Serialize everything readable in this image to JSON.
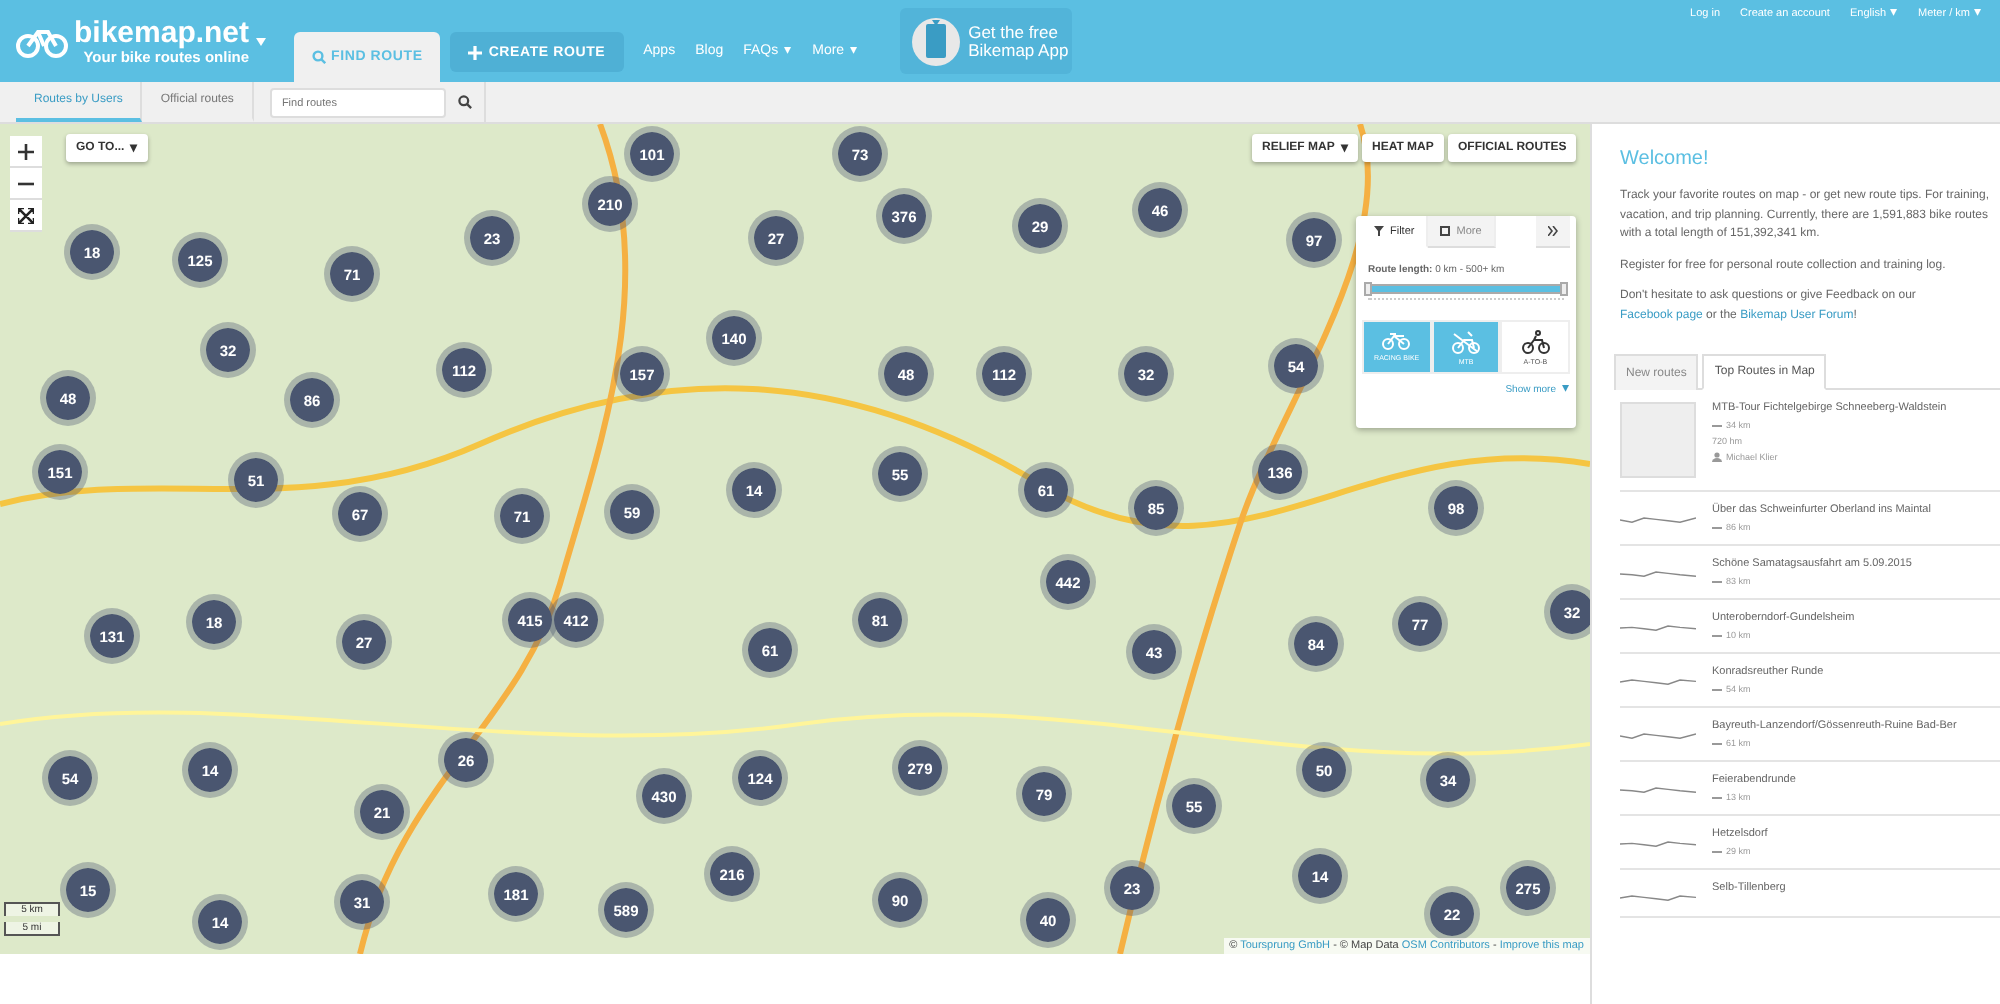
{
  "header": {
    "logo": "bikemap.net",
    "tagline": "Your bike routes online",
    "tabs": [
      {
        "label": "FIND ROUTE",
        "kind": "find",
        "selected": true
      },
      {
        "label": "CREATE ROUTE",
        "kind": "create",
        "selected": false
      }
    ],
    "links": [
      {
        "label": "Apps"
      },
      {
        "label": "Blog"
      },
      {
        "label": "FAQs",
        "caret": "▾"
      },
      {
        "label": "More",
        "caret": "▾"
      }
    ],
    "promo": "Get the free Bikemap App",
    "account": [
      {
        "label": "Log in"
      },
      {
        "label": "Create an account"
      },
      {
        "label": "English",
        "caret": "▾"
      },
      {
        "label": "Meter / km",
        "caret": "▾"
      }
    ]
  },
  "subnav": {
    "tabs": [
      {
        "label": "Routes by Users",
        "selected": true
      },
      {
        "label": "Official routes",
        "selected": false
      }
    ],
    "search": {
      "placeholder": "Find routes"
    }
  },
  "map": {
    "goto": "GO TO...",
    "goto_caret": "▾",
    "layers": [
      {
        "label": "RELIEF MAP",
        "caret": "▾"
      },
      {
        "label": "HEAT MAP"
      },
      {
        "label": "OFFICIAL ROUTES"
      }
    ],
    "clusters": [
      "101",
      "73",
      "210",
      "376",
      "29",
      "46",
      "18",
      "125",
      "71",
      "23",
      "27",
      "97",
      "32",
      "112",
      "157",
      "140",
      "48",
      "112",
      "32",
      "54",
      "48",
      "86",
      "151",
      "51",
      "67",
      "71",
      "59",
      "14",
      "55",
      "61",
      "85",
      "136",
      "98",
      "131",
      "18",
      "27",
      "415",
      "412",
      "61",
      "81",
      "442",
      "43",
      "84",
      "77",
      "32",
      "54",
      "14",
      "21",
      "26",
      "430",
      "124",
      "279",
      "79",
      "55",
      "50",
      "34",
      "15",
      "14",
      "31",
      "181",
      "589",
      "216",
      "90",
      "40",
      "23",
      "14",
      "22",
      "275"
    ],
    "scale": [
      "5 km",
      "5 mi"
    ],
    "attribution": {
      "prefix": "©",
      "owner": "Toursprung GmbH",
      "data_label": "- © Map Data",
      "data_link": "OSM Contributors",
      "separator": "-",
      "improve": "Improve this map"
    },
    "filter": {
      "tabs": [
        {
          "label": "Filter",
          "selected": true
        },
        {
          "label": "More",
          "selected": false
        }
      ],
      "length_label": "**Route length:** 0 km - 500+ km",
      "length": {
        "level": 1
      },
      "bikes": [
        {
          "label": "RACING BIKE",
          "kind": "racing",
          "selected": true
        },
        {
          "label": "MTB",
          "kind": "mtb",
          "selected": true
        },
        {
          "label": "A-TO-B",
          "kind": "atob",
          "selected": false
        }
      ],
      "show_more": "Show more",
      "show_more_caret": "▾"
    }
  },
  "sidebar": {
    "title": "Welcome!",
    "paragraphs": [
      "Track your favorite routes on map - or get new route tips. For training, vacation, and trip planning. Currently, there are 1,591,883 bike routes with a total length of 151,392,341 km.",
      "Register for free for personal route collection and training log."
    ],
    "feedback": {
      "before": "Don't hesitate to ask questions or give Feedback on our",
      "link_1": "Facebook page",
      "middle": "or the",
      "link_2": "Bikemap User Forum",
      "after": "!"
    },
    "tabs": [
      {
        "label": "New routes",
        "selected": false
      },
      {
        "label": "Top Routes in Map",
        "selected": true
      }
    ],
    "routes": [
      {
        "kind": "photo",
        "name": "MTB-Tour Fichtelgebirge Schneeberg-Waldstein",
        "distance": "34 km",
        "climb": "720 hm",
        "author": "Michael Klier"
      },
      {
        "kind": "profile",
        "name": "Über das Schweinfurter Oberland ins Maintal",
        "distance": "86 km"
      },
      {
        "kind": "profile",
        "name": "Schöne Samatagsausfahrt am 5.09.2015",
        "distance": "83 km"
      },
      {
        "kind": "profile",
        "name": "Unteroberndorf-Gundelsheim",
        "distance": "10 km"
      },
      {
        "kind": "profile",
        "name": "Konradsreuther Runde",
        "distance": "54 km"
      },
      {
        "kind": "profile",
        "name": "Bayreuth-Lanzendorf/Gössenreuth-Ruine Bad-Ber",
        "distance": "61 km"
      },
      {
        "kind": "profile",
        "name": "Feierabendrunde",
        "distance": "13 km"
      },
      {
        "kind": "profile",
        "name": "Hetzelsdorf",
        "distance": "29 km"
      },
      {
        "kind": "profile",
        "name": "Selb-Tillenberg"
      }
    ]
  }
}
